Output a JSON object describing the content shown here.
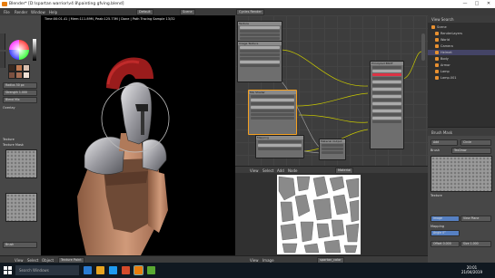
{
  "window": {
    "title": "Blender* [D:\\spartan warrior\\v4 8\\painting gfving.blend]",
    "min": "—",
    "max": "□",
    "close": "✕"
  },
  "header": {
    "menus": [
      "File",
      "Render",
      "Window",
      "Help"
    ],
    "layout": "Default",
    "scene": "Scene",
    "engine": "Cycles Render"
  },
  "tool_panel": {
    "items": [
      {
        "label": "Radius",
        "value": "50 px"
      },
      {
        "label": "Strength",
        "value": "1.000"
      },
      {
        "label": "Blend",
        "value": "Mix"
      }
    ],
    "overlay_title": "Overlay",
    "texture_title": "Texture",
    "texture_mapping": "Texture Mask",
    "bottom_button": "Brush",
    "colors": {
      "primary": "#3a2a20",
      "fg": "#c07a52",
      "bg": "#d9c0b0"
    }
  },
  "viewport": {
    "info": "Time:00:01.41 | Mem:111.89M, Peak:125.73M | Done | Path Tracing Sample 13/32",
    "footer_items": [
      "View",
      "Select",
      "Object",
      "Texture Paint"
    ]
  },
  "node_editor": {
    "footer_items": [
      "View",
      "Select",
      "Add",
      "Node"
    ],
    "material": "Material",
    "nodes": [
      {
        "title": "Texture"
      },
      {
        "title": "Image Texture"
      },
      {
        "title": "Mix Shader"
      },
      {
        "title": "Principled BSDF"
      },
      {
        "title": "Material Output"
      },
      {
        "title": "Mapping"
      }
    ]
  },
  "image_editor": {
    "footer_items": [
      "View",
      "Image"
    ],
    "image_name": "spartan_color"
  },
  "outliner": {
    "header": "View  Search",
    "rows": [
      "Scene",
      "RenderLayers",
      "World",
      "Camera",
      "Helmet",
      "Body",
      "Armor",
      "Lamp",
      "Lamp.001"
    ]
  },
  "properties": {
    "header": "Brush Mask",
    "items": [
      {
        "label": "Add",
        "value": "Circle"
      },
      {
        "label": "Brush",
        "value": "TexDraw"
      },
      {
        "label": "Texture",
        "value": "Image"
      },
      {
        "label": "Mapping",
        "value": "View Plane"
      },
      {
        "label": "Angle",
        "value": "0°"
      },
      {
        "label": "Offset",
        "value": "0.000"
      },
      {
        "label": "Size",
        "value": "1.000"
      }
    ]
  },
  "taskbar": {
    "search": "Search Windows",
    "time": "20:01",
    "date": "21/04/2019",
    "icon_colors": [
      "#2b7cd3",
      "#e8a420",
      "#1f9aee",
      "#d44a2a",
      "#e87d0d",
      "#5aa832"
    ]
  }
}
